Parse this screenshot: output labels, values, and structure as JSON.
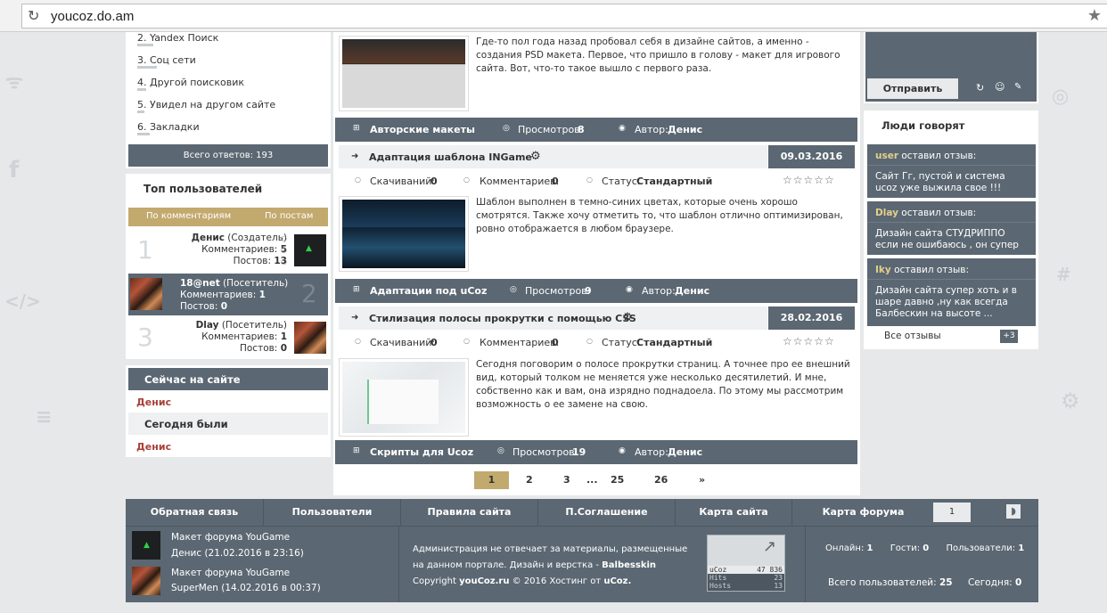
{
  "browser": {
    "url": "youcoz.do.am"
  },
  "poll": {
    "items": [
      "2. Yandex Поиск",
      "3. Соц сети",
      "4. Другой поисковик",
      "5. Увидел на другом сайте",
      "6. Закладки"
    ],
    "total": "Всего ответов: 193"
  },
  "top_users": {
    "title": "Топ пользователей",
    "tab_comments": "По комментариям",
    "tab_posts": "По постам",
    "users": [
      {
        "rank": "1",
        "name": "Денис",
        "role": "(Создатель)",
        "comments_label": "Комментариев:",
        "comments": "5",
        "posts_label": "Постов:",
        "posts": "13"
      },
      {
        "rank": "2",
        "name": "18@net",
        "role": "(Посетитель)",
        "comments_label": "Комментариев:",
        "comments": "1",
        "posts_label": "Постов:",
        "posts": "0"
      },
      {
        "rank": "3",
        "name": "Dlay",
        "role": "(Посетитель)",
        "comments_label": "Комментариев:",
        "comments": "1",
        "posts_label": "Постов:",
        "posts": "0"
      }
    ]
  },
  "online": {
    "title": "Сейчас на сайте",
    "user": "Денис",
    "today_title": "Сегодня были",
    "today_user": "Денис"
  },
  "articles": {
    "top_desc": "Где-то пол года назад пробовал себя в дизайне сайтов, а именно - создания PSD макета. Первое, что пришло в голову - макет для игрового сайта. Вот, что-то такое вышло с первого раза.",
    "cat1": {
      "name": "Авторские макеты",
      "views_label": "Просмотров:",
      "views": "8",
      "author_label": "Автор:",
      "author": "Денис"
    },
    "a1": {
      "title": "Адаптация шаблона INGame",
      "date": "09.03.2016",
      "downloads_label": "Скачиваний:",
      "downloads": "0",
      "comments_label": "Комментариев:",
      "comments": "0",
      "status_label": "Статус:",
      "status": "Стандартный",
      "desc": "Шаблон выполнен в темно-синих цветах, которые очень хорошо смотрятся. Также хочу отметить то, что шаблон отлично оптимизирован, ровно отображается в любом браузере."
    },
    "cat2": {
      "name": "Адаптации под uCoz",
      "views_label": "Просмотров:",
      "views": "9",
      "author_label": "Автор:",
      "author": "Денис"
    },
    "a2": {
      "title": "Стилизация полосы прокрутки с помощью CSS",
      "date": "28.02.2016",
      "downloads_label": "Скачиваний:",
      "downloads": "0",
      "comments_label": "Комментариев:",
      "comments": "0",
      "status_label": "Статус:",
      "status": "Стандартный",
      "desc": "Сегодня поговорим о полосе прокрутки страниц. А точнее про ее внешний вид, который толком не меняется уже несколько десятилетий. И мне, собственно как и вам, она изрядно поднадоела. По этому мы рассмотрим возможность о ее замене на свою."
    },
    "cat3": {
      "name": "Скрипты для Ucoz",
      "views_label": "Просмотров:",
      "views": "19",
      "author_label": "Автор:",
      "author": "Денис"
    },
    "pager": [
      "1",
      "2",
      "3",
      "...",
      "25",
      "26",
      "»"
    ]
  },
  "reviews": {
    "send_button": "Отправить",
    "title": "Люди говорят",
    "items": [
      {
        "user": "user",
        "action": "оставил отзыв:",
        "text": "Сайт Гг, пустой и система ucoz уже выжила свое !!!"
      },
      {
        "user": "Dlay",
        "action": "оставил отзыв:",
        "text": "Дизайн сайта СТУДРИППО если не ошибаюсь , он супер"
      },
      {
        "user": "Iky",
        "action": "оставил отзыв:",
        "text": "Дизайн сайта супер хоть и в шаре давно ,ну как всегда Балбескин на высоте ..."
      }
    ],
    "all_label": "Все отзывы",
    "more_count": "+3"
  },
  "footer": {
    "nav": [
      "Обратная связь",
      "Пользователи",
      "Правила сайта",
      "П.Соглашение",
      "Карта сайта",
      "Карта форума"
    ],
    "page_num": "1",
    "latest": [
      {
        "title": "Макет форума YouGame",
        "meta": "Денис (21.02.2016 в 23:16)"
      },
      {
        "title": "Макет форума YouGame",
        "meta": "SuperMen (14.02.2016 в 00:37)"
      }
    ],
    "disclaimer_1": "Администрация не отвечает за материалы, размещенные",
    "disclaimer_2": "на данном портале. Дизайн и верстка -",
    "designer": "Balbesskin",
    "copyright_1": "Copyright",
    "site": "youCoz.ru",
    "copyright_2": "© 2016 Хостинг от",
    "host": "uCoz.",
    "counter": {
      "brand": "uCoz",
      "total": "47 836",
      "hits_label": "Hits",
      "hits": "23",
      "hosts_label": "Hosts",
      "hosts": "13"
    },
    "stats": {
      "online_label": "Онлайн:",
      "online": "1",
      "guests_label": "Гости:",
      "guests": "0",
      "users_label": "Пользователи:",
      "users": "1",
      "total_label": "Всего пользователей:",
      "total": "25",
      "today_label": "Сегодня:",
      "today": "0"
    }
  }
}
